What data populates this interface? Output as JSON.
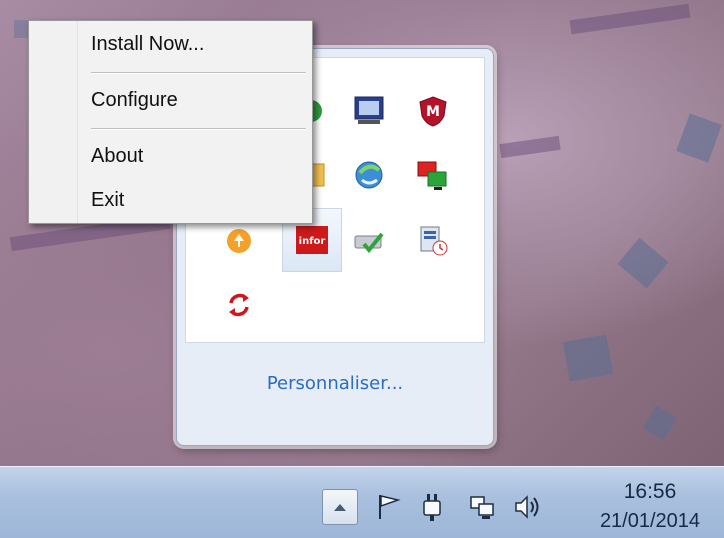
{
  "context_menu": {
    "items": [
      {
        "label": "Install Now..."
      },
      {
        "label": "Configure"
      },
      {
        "label": "About"
      },
      {
        "label": "Exit"
      }
    ]
  },
  "tray_panel": {
    "customize_label": "Personnaliser...",
    "icons": [
      "green-circle-icon",
      "monitor-icon",
      "mcafee-shield-icon",
      "orange-folder-icon",
      "globe-arrow-icon",
      "network-monitors-icon",
      "orange-circle-icon",
      "infor-app-icon",
      "drive-check-icon",
      "network-clock-icon",
      "red-refresh-icon"
    ],
    "infor_label": "infor"
  },
  "taskbar": {
    "time": "16:56",
    "date": "21/01/2014",
    "icons": [
      "show-hidden-icons-chevron",
      "action-center-flag-icon",
      "power-plug-icon",
      "network-icon",
      "volume-icon"
    ]
  },
  "colors": {
    "link_blue": "#2a6cc2",
    "taskbar": "#a9c0de"
  }
}
